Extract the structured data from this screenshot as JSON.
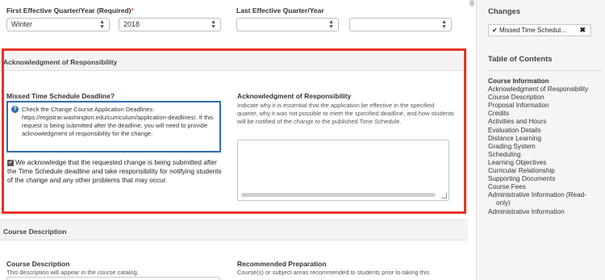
{
  "form": {
    "first_effective": {
      "label": "First Effective Quarter/Year (Required)",
      "required_mark": "*",
      "quarter_value": "Winter",
      "year_value": "2018"
    },
    "last_effective": {
      "label": "Last Effective Quarter/Year",
      "quarter_value": "",
      "year_value": ""
    },
    "ack_section": {
      "title": "Acknowledgment of Responsibility",
      "missed_label": "Missed Time Schedule Deadline?",
      "help_icon": "question-icon",
      "note_icon": "question-circle-icon",
      "note_text": "Check the Change Course Application Deadlines: https://registrar.washington.edu/curriculum/application-deadlines/. If this request is being submitted after the deadline, you will need to provide acknowledgment of responsibility for the change.",
      "checkbox_checked": true,
      "checkbox_text": "We acknowledge that the requested change is being submitted after the Time Schedule deadline and take responsibility for notifying students of the change and any other problems that may occur.",
      "ack_label": "Acknowledgment of Responsibility",
      "ack_help": "Indicate why it is essential that the application be effective in the specified quarter, why it was not possible to meet the specified deadline, and how students will be notified of the change to the published Time Schedule.",
      "ack_value": ""
    },
    "course_section": {
      "title": "Course Description",
      "desc_label": "Course Description",
      "desc_help": "This description will appear in the course catalog.",
      "prep_label": "Recommended Preparation",
      "prep_help": "Course(s) or subject areas recommended to students prior to taking this"
    }
  },
  "sidebar": {
    "changes_title": "Changes",
    "change_tag": "Missed Time Schedul...",
    "change_tag_icon": "check-icon",
    "change_tag_remove_icon": "close-icon",
    "toc_title": "Table of Contents",
    "toc_items": [
      "Course Information",
      "Acknowledgment of Responsibility",
      "Course Description",
      "Proposal Information",
      "Credits",
      "Activities and Hours",
      "Evaluation Details",
      "Distance Learning",
      "Grading System",
      "Scheduling",
      "Learning Objectives",
      "Curricular Relationship",
      "Supporting Documents",
      "Course Fees",
      "Administrative Information (Read-",
      "only)",
      "Administrative Information"
    ]
  },
  "colors": {
    "highlight": "#e53427",
    "note_border": "#2f6db0",
    "required": "#d9534f"
  }
}
